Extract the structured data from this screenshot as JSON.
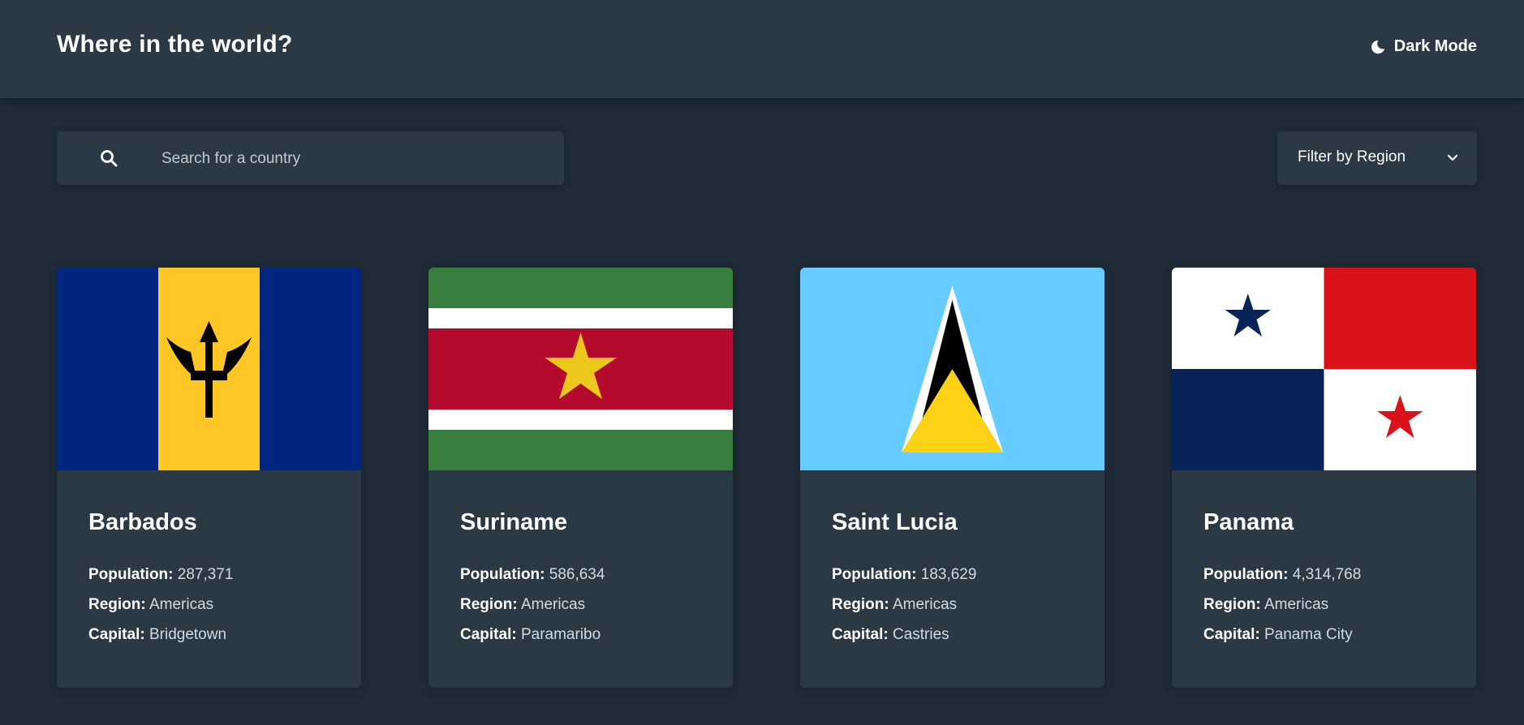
{
  "header": {
    "title": "Where in the world?",
    "theme_toggle_label": "Dark Mode"
  },
  "search": {
    "placeholder": "Search for a country",
    "value": ""
  },
  "filter": {
    "label": "Filter by Region"
  },
  "fields": {
    "population": "Population:",
    "region": "Region:",
    "capital": "Capital:"
  },
  "countries": [
    {
      "name": "Barbados",
      "population": "287,371",
      "region": "Americas",
      "capital": "Bridgetown"
    },
    {
      "name": "Suriname",
      "population": "586,634",
      "region": "Americas",
      "capital": "Paramaribo"
    },
    {
      "name": "Saint Lucia",
      "population": "183,629",
      "region": "Americas",
      "capital": "Castries"
    },
    {
      "name": "Panama",
      "population": "4,314,768",
      "region": "Americas",
      "capital": "Panama City"
    }
  ],
  "colors": {
    "background": "#202c37",
    "surface": "#2b3945",
    "text": "#ffffff"
  }
}
